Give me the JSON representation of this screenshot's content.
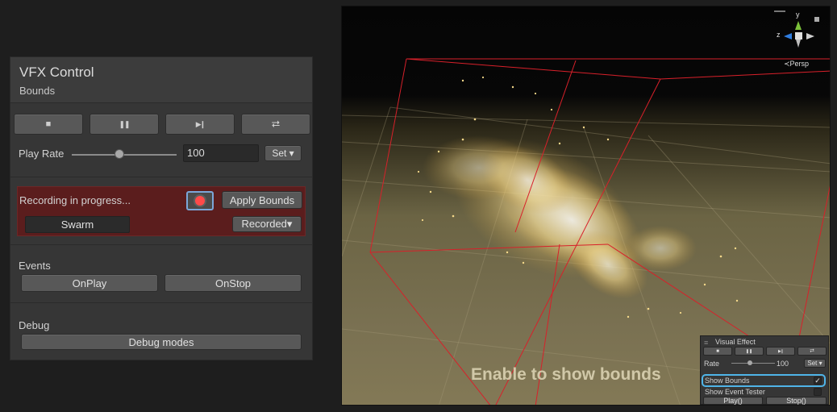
{
  "panel": {
    "title": "VFX Control",
    "subtitle": "Bounds",
    "controls": {
      "stop_icon": "■",
      "pause_icon": "❚❚",
      "step_icon": "▶❙",
      "restart_icon": "⮂"
    },
    "play_rate": {
      "label": "Play Rate",
      "value": "100",
      "set_label": "Set ▾",
      "slider_fraction": 0.45
    },
    "recording": {
      "status": "Recording in progress...",
      "apply_label": "Apply Bounds",
      "system_name": "Swarm",
      "mode_label": "Recorded▾",
      "accent": "#ff4a4a"
    },
    "events": {
      "label": "Events",
      "on_play": "OnPlay",
      "on_stop": "OnStop"
    },
    "debug": {
      "label": "Debug",
      "modes_label": "Debug modes"
    }
  },
  "viewport": {
    "persp_label": "≺Persp",
    "caption": "Enable to show bounds",
    "bounds_color": "#d8202a",
    "gizmo": {
      "y": "y",
      "z": "z"
    }
  },
  "mini": {
    "title": "Visual Effect",
    "rate_label": "Rate",
    "rate_value": "100",
    "set_label": "Set ▾",
    "show_bounds": "Show Bounds",
    "show_bounds_check": "✓",
    "show_event_tester": "Show Event Tester",
    "play": "Play()",
    "stop": "Stop()",
    "highlight_color": "#4fb4e8",
    "icons": {
      "stop": "■",
      "pause": "❚❚",
      "step": "▶❙",
      "restart": "⮂"
    }
  }
}
